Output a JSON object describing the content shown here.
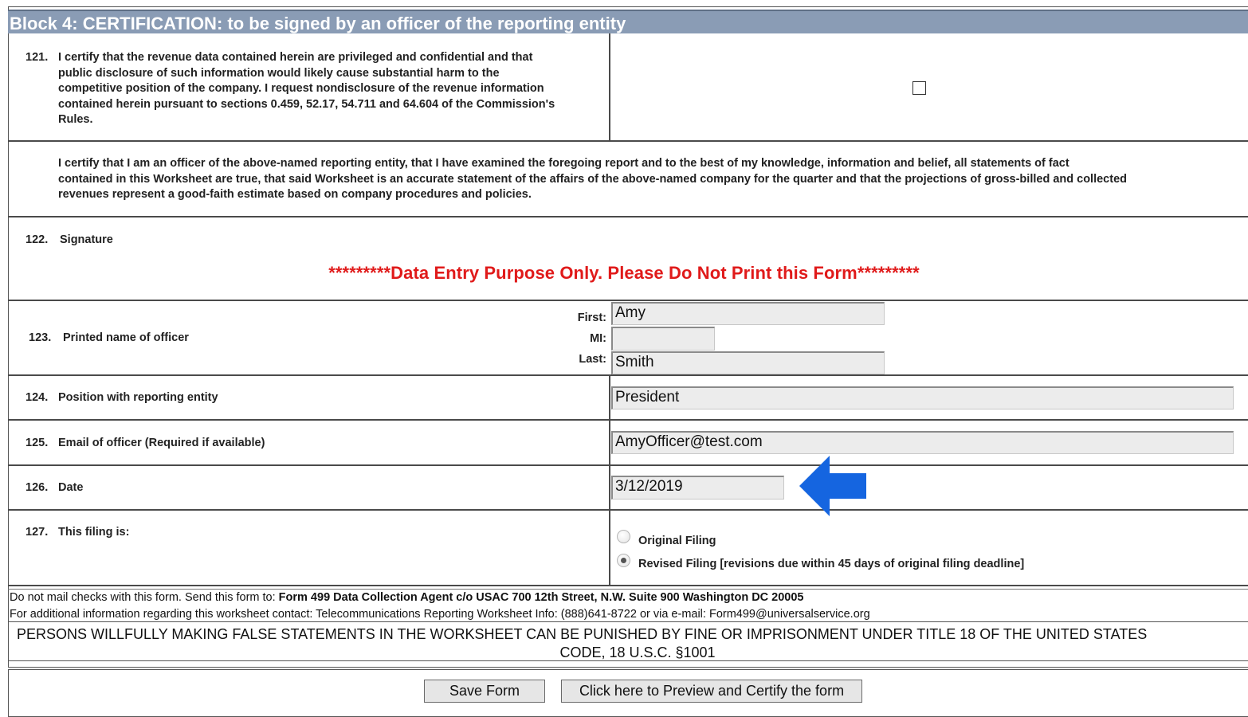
{
  "block": {
    "title": "Block 4: CERTIFICATION: to be signed by an officer of the reporting entity"
  },
  "q121": {
    "number": "121.",
    "lines": [
      "I certify that the revenue data contained herein are privileged and confidential and that",
      "public disclosure of such information would likely cause substantial harm to the",
      "competitive position of the company. I request nondisclosure of the revenue information",
      "contained herein pursuant to sections 0.459, 52.17, 54.711 and 64.604 of the Commission's",
      "Rules."
    ],
    "checked": false
  },
  "certify_statement": {
    "lines": [
      "I certify that I am an officer of the above-named reporting entity, that I have examined the foregoing report and to the best of my knowledge, information and belief, all statements of fact",
      "contained in this Worksheet are true, that said Worksheet is an accurate statement of the affairs of the above-named company for the quarter and that the projections of gross-billed and collected",
      "revenues represent a good-faith estimate based on company procedures and policies."
    ]
  },
  "q122": {
    "number": "122.",
    "label": "Signature",
    "warning": "*********Data Entry Purpose Only. Please Do Not Print this Form*********"
  },
  "q123": {
    "number": "123.",
    "label": "Printed name of officer",
    "first_label": "First:",
    "mi_label": "MI:",
    "last_label": "Last:",
    "first_value": "Amy",
    "mi_value": "",
    "last_value": "Smith"
  },
  "q124": {
    "number": "124.",
    "label": "Position with reporting entity",
    "value": "President"
  },
  "q125": {
    "number": "125.",
    "label": "Email of officer (Required if available)",
    "value": "AmyOfficer@test.com"
  },
  "q126": {
    "number": "126.",
    "label": "Date",
    "value": "3/12/2019"
  },
  "q127": {
    "number": "127.",
    "label": "This filing is:",
    "options": [
      {
        "label": "Original Filing",
        "selected": false
      },
      {
        "label": "Revised Filing [revisions due within 45 days of original filing deadline]",
        "selected": true
      }
    ]
  },
  "footer": {
    "mail_prefix": "Do not mail checks with this form. Send this form to: ",
    "mail_address": "Form 499 Data Collection Agent c/o USAC 700 12th Street, N.W. Suite 900 Washington DC 20005",
    "contact": "For additional information regarding this worksheet contact: Telecommunications Reporting Worksheet Info: (888)641-8722 or via e-mail: Form499@universalservice.org",
    "legal_line1": "PERSONS WILLFULLY MAKING FALSE STATEMENTS IN THE WORKSHEET CAN BE PUNISHED BY FINE OR IMPRISONMENT UNDER TITLE 18 OF THE UNITED STATES",
    "legal_line2": "CODE, 18 U.S.C. §1001"
  },
  "buttons": {
    "save": "Save Form",
    "preview": "Click here to Preview and Certify the form"
  },
  "icons": {
    "arrow": "arrow-left-icon",
    "arrow_color": "#1565e0"
  }
}
